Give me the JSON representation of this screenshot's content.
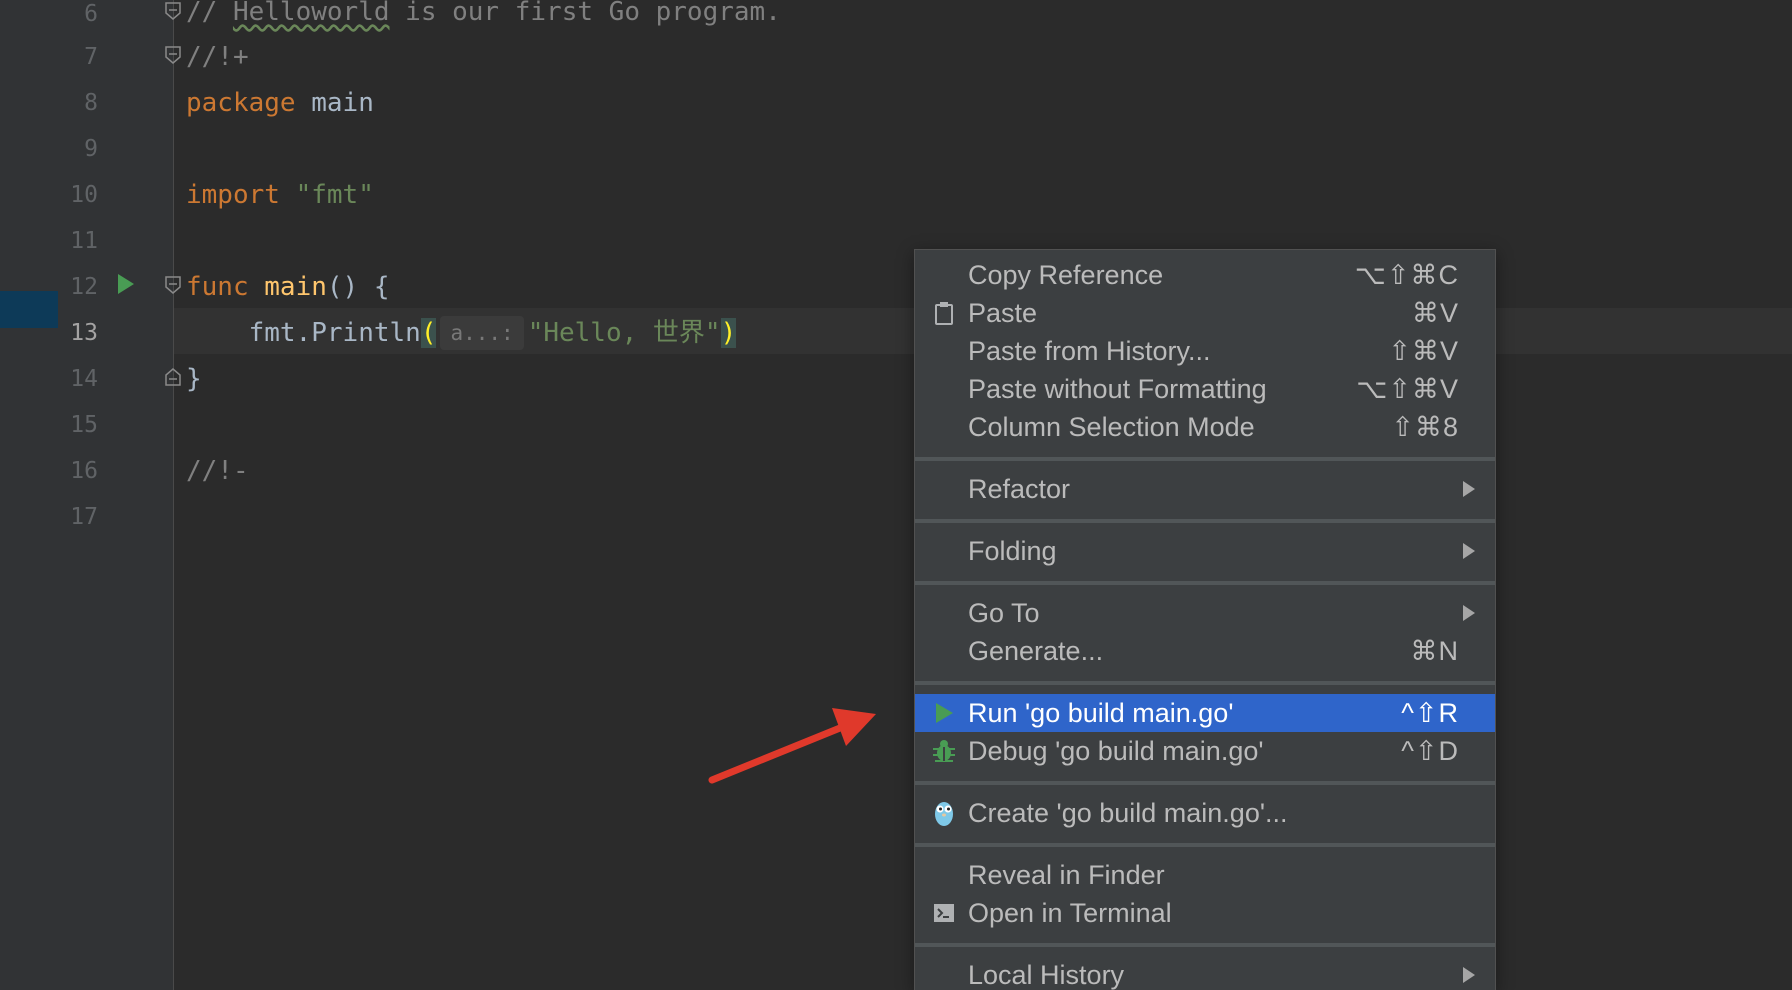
{
  "editor": {
    "line_numbers": [
      "6",
      "7",
      "8",
      "9",
      "10",
      "11",
      "12",
      "13",
      "14",
      "15",
      "16",
      "17"
    ],
    "current_line": "13",
    "lines": {
      "l6": {
        "prefix": "// ",
        "underlined": "Helloworld",
        "rest": " is our first Go program."
      },
      "l7": {
        "text": "//!+"
      },
      "l8": {
        "kw": "package",
        "ident": " main"
      },
      "l10": {
        "kw": "import",
        "str": " \"fmt\""
      },
      "l12": {
        "kw": "func",
        "fn": " main",
        "rest": "() {"
      },
      "l13": {
        "indent": "    ",
        "call": "fmt.Println",
        "open": "(",
        "hint": "a...:",
        "str": "\"Hello, 世界\"",
        "close": ")"
      },
      "l14": {
        "text": "}"
      },
      "l16": {
        "text": "//!-"
      }
    }
  },
  "context_menu": {
    "items": {
      "copy_reference": {
        "label": "Copy Reference",
        "shortcut": "⌥⇧⌘C"
      },
      "paste": {
        "label": "Paste",
        "shortcut": "⌘V"
      },
      "paste_history": {
        "label": "Paste from History...",
        "shortcut": "⇧⌘V"
      },
      "paste_no_format": {
        "label": "Paste without Formatting",
        "shortcut": "⌥⇧⌘V"
      },
      "column_selection": {
        "label": "Column Selection Mode",
        "shortcut": "⇧⌘8"
      },
      "refactor": {
        "label": "Refactor"
      },
      "folding": {
        "label": "Folding"
      },
      "go_to": {
        "label": "Go To"
      },
      "generate": {
        "label": "Generate...",
        "shortcut": "⌘N"
      },
      "run": {
        "label": "Run 'go build main.go'",
        "shortcut": "^⇧R"
      },
      "debug": {
        "label": "Debug 'go build main.go'",
        "shortcut": "^⇧D"
      },
      "create": {
        "label": "Create 'go build main.go'..."
      },
      "reveal_finder": {
        "label": "Reveal in Finder"
      },
      "open_terminal": {
        "label": "Open in Terminal"
      },
      "local_history": {
        "label": "Local History"
      }
    },
    "icons": {
      "paste": "clipboard-icon",
      "run": "play-icon",
      "debug": "bug-icon",
      "create": "gopher-icon",
      "terminal": "terminal-icon"
    },
    "colors": {
      "active_bg": "#2f65ca",
      "run_green": "#499c54",
      "annotation_arrow": "#e0392b"
    }
  }
}
